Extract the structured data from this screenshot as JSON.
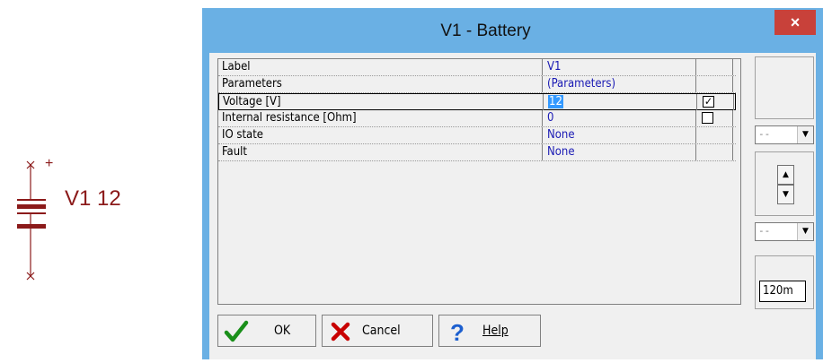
{
  "schematic": {
    "designator": "V1",
    "value": "12",
    "plus_sign": "+"
  },
  "dialog": {
    "title": "V1 - Battery",
    "close_glyph": "×",
    "title_color": "#6ab0e4",
    "close_color": "#c8413a"
  },
  "properties": [
    {
      "label": "Label",
      "value": "V1",
      "checkbox": null
    },
    {
      "label": "Parameters",
      "value": "(Parameters)",
      "checkbox": null
    },
    {
      "label": "Voltage [V]",
      "value": "12",
      "checkbox": true,
      "selected": true
    },
    {
      "label": "Internal resistance [Ohm]",
      "value": "0",
      "checkbox": false
    },
    {
      "label": "IO state",
      "value": "None",
      "checkbox": null
    },
    {
      "label": "Fault",
      "value": "None",
      "checkbox": null
    }
  ],
  "right_panel": {
    "combo1_value": "--",
    "combo2_value": "--",
    "step_value": "120m"
  },
  "buttons": {
    "ok": "OK",
    "cancel": "Cancel",
    "help": "Help"
  },
  "icons": {
    "ok": "checkmark-icon",
    "cancel": "x-cross-icon",
    "help": "question-mark-icon"
  }
}
